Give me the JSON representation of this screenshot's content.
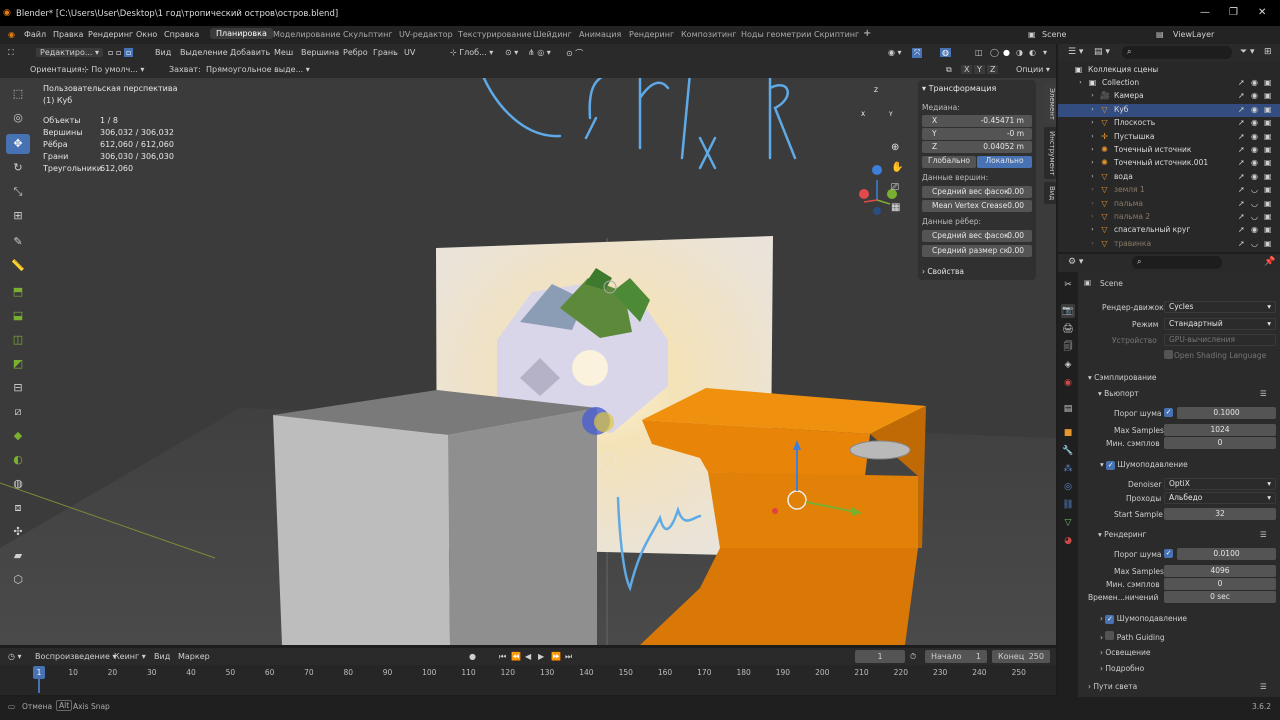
{
  "window": {
    "title": "Blender* [C:\\Users\\User\\Desktop\\1 год\\тропический остров\\остров.blend]",
    "minimize": "—",
    "maximize": "❐",
    "close": "✕"
  },
  "menu": {
    "items": [
      "Файл",
      "Правка",
      "Рендеринг",
      "Окно",
      "Справка"
    ],
    "workspaces": [
      "Планировка",
      "Моделирование",
      "Скульптинг",
      "UV-редактор",
      "Текстурирование",
      "Шейдинг",
      "Анимация",
      "Рендеринг",
      "Композитинг",
      "Ноды геометрии",
      "Скриптинг"
    ],
    "active_workspace": "Планировка",
    "add_tab": "+",
    "scene": "Scene",
    "view_layer": "ViewLayer"
  },
  "viewport_header": {
    "mode": "Редактиро...",
    "menus": [
      "Вид",
      "Выделение",
      "Добавить",
      "Меш",
      "Вершина",
      "Ребро",
      "Грань",
      "UV"
    ],
    "transform": "Глоб...",
    "orientation_label": "Ориентация:",
    "orientation_value": "По умолч...",
    "snap_label": "Захват:",
    "snap_value": "Прямоугольное выде...",
    "axes": [
      "X",
      "Y",
      "Z"
    ],
    "options": "Опции"
  },
  "viewport_overlay": {
    "view_name": "Пользовательская перспектива",
    "object": "(1) Куб",
    "stats": [
      {
        "label": "Объекты",
        "value": "1 / 8"
      },
      {
        "label": "Вершины",
        "value": "306,032 / 306,032"
      },
      {
        "label": "Рёбра",
        "value": "612,060 / 612,060"
      },
      {
        "label": "Грани",
        "value": "306,030 / 306,030"
      },
      {
        "label": "Треугольники",
        "value": "612,060"
      }
    ],
    "gizmo_axes": [
      "X",
      "Y",
      "Z"
    ],
    "handwriting": "LCTf×R"
  },
  "npanel": {
    "section": "Трансформация",
    "median_label": "Медиана:",
    "x_label": "X",
    "x_value": "-0.45471 m",
    "y_label": "Y",
    "y_value": "-0 m",
    "z_label": "Z",
    "z_value": "0.04052 m",
    "global_btn": "Глобально",
    "local_btn": "Локально",
    "vertex_data": "Данные вершин:",
    "bevel_weight_v": "Средний вес фасок",
    "bevel_weight_v_val": "0.00",
    "vertex_crease": "Mean Vertex Crease",
    "vertex_crease_val": "0.00",
    "edge_data": "Данные рёбер:",
    "bevel_weight_e": "Средний вес фасок",
    "bevel_weight_e_val": "0.00",
    "crease_e": "Средний размер ск",
    "crease_e_val": "0.00",
    "properties": "Свойства",
    "tabs": [
      "Элемент",
      "Инструмент",
      "Вид"
    ]
  },
  "outliner": {
    "root": "Коллекция сцены",
    "items": [
      {
        "name": "Collection",
        "icon": "collection-icon",
        "indent": 0,
        "state": "normal"
      },
      {
        "name": "Камера",
        "icon": "camera-icon",
        "indent": 1,
        "state": "normal"
      },
      {
        "name": "Куб",
        "icon": "mesh-icon",
        "indent": 1,
        "state": "selected"
      },
      {
        "name": "Плоскость",
        "icon": "mesh-icon",
        "indent": 1,
        "state": "normal"
      },
      {
        "name": "Пустышка",
        "icon": "empty-icon",
        "indent": 1,
        "state": "normal"
      },
      {
        "name": "Точечный источник",
        "icon": "light-icon",
        "indent": 1,
        "state": "normal"
      },
      {
        "name": "Точечный источник.001",
        "icon": "light-icon",
        "indent": 1,
        "state": "normal"
      },
      {
        "name": "вода",
        "icon": "mesh-icon",
        "indent": 1,
        "state": "normal"
      },
      {
        "name": "земля 1",
        "icon": "mesh-icon",
        "indent": 1,
        "state": "hidden"
      },
      {
        "name": "пальма",
        "icon": "mesh-icon",
        "indent": 1,
        "state": "hidden"
      },
      {
        "name": "пальма 2",
        "icon": "mesh-icon",
        "indent": 1,
        "state": "hidden"
      },
      {
        "name": "спасательный круг",
        "icon": "mesh-icon",
        "indent": 1,
        "state": "normal"
      },
      {
        "name": "травинка",
        "icon": "mesh-icon",
        "indent": 1,
        "state": "hidden"
      }
    ]
  },
  "properties": {
    "scene": "Scene",
    "render_engine_label": "Рендер-движок",
    "render_engine": "Cycles",
    "mode_label": "Режим",
    "mode": "Стандартный",
    "device_label": "Устройство",
    "device": "GPU-вычисления",
    "osl": "Open Shading Language",
    "sampling": "Сэмплирование",
    "viewport": "Вьюпорт",
    "noise_threshold": "Порог шума",
    "noise_threshold_vp": "0.1000",
    "max_samples": "Max Samples",
    "max_samples_vp": "1024",
    "min_samples": "Мин. сэмплов",
    "min_samples_vp": "0",
    "denoise": "Шумоподавление",
    "denoiser_label": "Denoiser",
    "denoiser": "OptiX",
    "passes_label": "Проходы",
    "passes": "Альбедо",
    "start_sample_label": "Start Sample",
    "start_sample": "32",
    "render": "Рендеринг",
    "noise_threshold_r": "0.0100",
    "max_samples_r": "4096",
    "min_samples_r": "0",
    "time_limit_label": "Времен...ничений",
    "time_limit": "0 sec",
    "denoise_r": "Шумоподавление",
    "path_guiding": "Path Guiding",
    "lights": "Освещение",
    "advanced": "Подробно",
    "light_paths": "Пути света"
  },
  "timeline": {
    "playback": "Воспроизведение",
    "keying": "Кеинг",
    "view": "Вид",
    "marker": "Маркер",
    "current_frame": "1",
    "start_label": "Начало",
    "start": "1",
    "end_label": "Конец",
    "end": "250",
    "ticks": [
      "1",
      "10",
      "20",
      "30",
      "40",
      "50",
      "60",
      "70",
      "80",
      "90",
      "100",
      "110",
      "120",
      "130",
      "140",
      "150",
      "160",
      "170",
      "180",
      "190",
      "200",
      "210",
      "220",
      "230",
      "240",
      "250"
    ]
  },
  "status": {
    "cancel": "Отмена",
    "alt_key": "Alt",
    "axis_snap": "Axis Snap",
    "version": "3.6.2"
  }
}
